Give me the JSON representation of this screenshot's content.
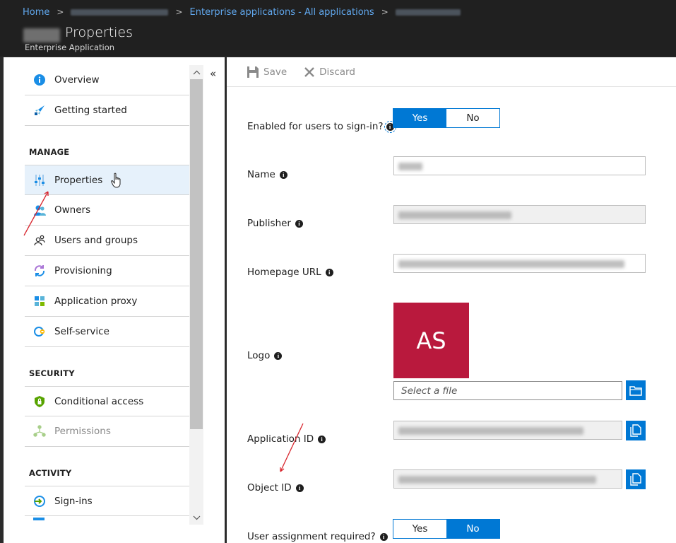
{
  "breadcrumb": {
    "home": "Home",
    "enterprise_apps": "Enterprise applications - All applications"
  },
  "header": {
    "title": "Properties",
    "subtitle": "Enterprise Application"
  },
  "nav": {
    "overview": "Overview",
    "getting_started": "Getting started",
    "manage_heading": "MANAGE",
    "properties": "Properties",
    "owners": "Owners",
    "users_groups": "Users and groups",
    "provisioning": "Provisioning",
    "app_proxy": "Application proxy",
    "self_service": "Self-service",
    "security_heading": "SECURITY",
    "conditional_access": "Conditional access",
    "permissions": "Permissions",
    "activity_heading": "ACTIVITY",
    "sign_ins": "Sign-ins",
    "collapse": "«"
  },
  "toolbar": {
    "save": "Save",
    "discard": "Discard"
  },
  "form": {
    "enabled_label": "Enabled for users to sign-in?",
    "enabled_yes": "Yes",
    "enabled_no": "No",
    "enabled_selected": "Yes",
    "name_label": "Name",
    "publisher_label": "Publisher",
    "homepage_label": "Homepage URL",
    "logo_label": "Logo",
    "logo_initials": "AS",
    "file_placeholder": "Select a file",
    "app_id_label": "Application ID",
    "object_id_label": "Object ID",
    "assignment_label": "User assignment required?",
    "assignment_yes": "Yes",
    "assignment_no": "No",
    "assignment_selected": "No"
  },
  "colors": {
    "accent": "#0078d4",
    "logo_bg": "#b9193d",
    "header_bg": "#202020",
    "link": "#61a8ee"
  }
}
